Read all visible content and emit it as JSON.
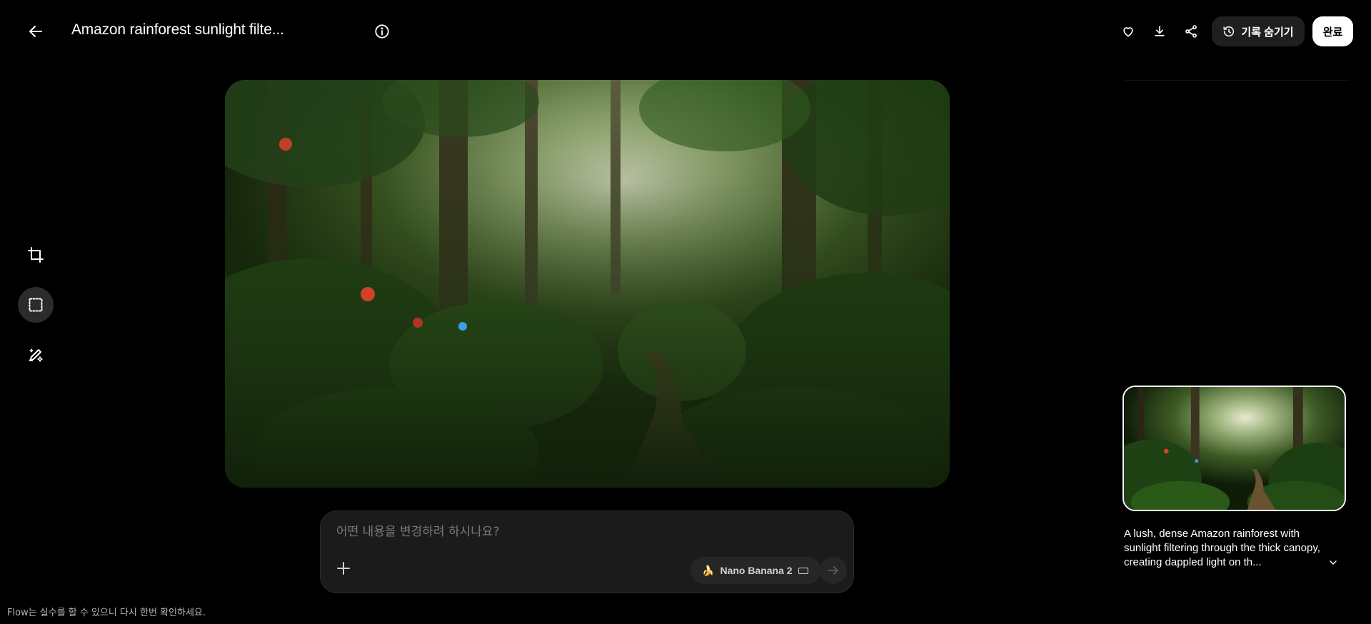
{
  "header": {
    "title": "Amazon rainforest sunlight filte...",
    "history_button_label": "기록 숨기기",
    "done_button_label": "완료"
  },
  "prompt": {
    "placeholder": "어떤 내용을 변경하려 하시나요?",
    "value": "",
    "model_label": "Nano Banana 2"
  },
  "disclaimer": "Flow는 실수를 할 수 있으니 다시 한번 확인하세요.",
  "history": {
    "caption": "A lush, dense Amazon rainforest with sunlight filtering through the thick canopy, creating dappled light on th..."
  },
  "icons": {
    "back": "arrow-left-icon",
    "info": "info-icon",
    "favorite": "heart-icon",
    "download": "download-icon",
    "share": "share-icon",
    "history": "history-icon",
    "crop": "crop-icon",
    "select": "marquee-select-icon",
    "edit": "pencil-sparkle-icon",
    "add": "plus-icon",
    "send": "arrow-right-icon",
    "expand": "chevron-down-icon"
  },
  "colors": {
    "background": "#000000",
    "panel": "#1b1b1b",
    "chip": "#262626",
    "done_button": "#ffffff"
  }
}
